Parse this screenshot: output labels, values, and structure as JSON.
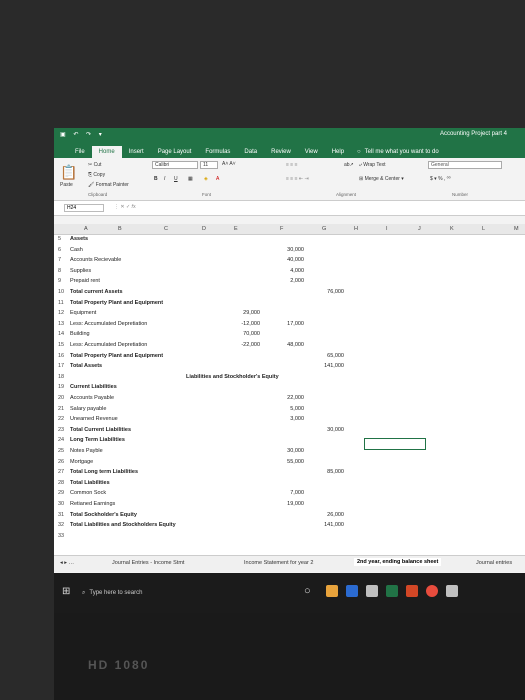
{
  "window": {
    "title": "Accounting Project part 4"
  },
  "tabs": [
    "File",
    "Home",
    "Insert",
    "Page Layout",
    "Formulas",
    "Data",
    "Review",
    "View",
    "Help"
  ],
  "tell_me": "Tell me what you want to do",
  "ribbon": {
    "cut": "Cut",
    "copy": "Copy",
    "format_painter": "Format Painter",
    "paste": "Paste",
    "font": "Calibri",
    "size": "11",
    "wrap_text": "Wrap Text",
    "merge_center": "Merge & Center",
    "number_format": "General",
    "groups": {
      "clipboard": "Clipboard",
      "font": "Font",
      "alignment": "Alignment",
      "number": "Number"
    }
  },
  "formula_bar": {
    "name_box": "H24"
  },
  "columns": [
    "A",
    "B",
    "C",
    "D",
    "E",
    "F",
    "G",
    "H",
    "I",
    "J",
    "K",
    "L",
    "M"
  ],
  "rows": [
    {
      "n": "5",
      "label": "Assets",
      "bold": true
    },
    {
      "n": "6",
      "label": "Cash",
      "f": "30,000"
    },
    {
      "n": "7",
      "label": "Accounts Recievable",
      "f": "40,000"
    },
    {
      "n": "8",
      "label": "Supplies",
      "f": "4,000"
    },
    {
      "n": "9",
      "label": "Prepaid rent",
      "f": "2,000"
    },
    {
      "n": "10",
      "label": "Total current Assets",
      "bold": true,
      "g": "76,000"
    },
    {
      "n": "11",
      "label": "Total Property Plant and Equipment",
      "bold": true
    },
    {
      "n": "12",
      "label": "Equipment",
      "e": "29,000"
    },
    {
      "n": "13",
      "label": "Less: Accumulated Depretiation",
      "e": "-12,000",
      "f": "17,000"
    },
    {
      "n": "14",
      "label": "Building",
      "e": "70,000"
    },
    {
      "n": "15",
      "label": "Less: Accumulated Depretiation",
      "e": "-22,000",
      "f": "48,000"
    },
    {
      "n": "16",
      "label": "Total Property Plant and Equipment",
      "bold": true,
      "g": "65,000"
    },
    {
      "n": "17",
      "label": "Total Assets",
      "bold": true,
      "g": "141,000"
    },
    {
      "n": "18",
      "label": "",
      "mid": "Liabilities and Stockholder's Equity"
    },
    {
      "n": "19",
      "label": "Current Liabilities",
      "bold": true
    },
    {
      "n": "20",
      "label": "Accounts Payable",
      "f": "22,000"
    },
    {
      "n": "21",
      "label": "Salary payable",
      "f": "5,000"
    },
    {
      "n": "22",
      "label": "Unearned Revenue",
      "f": "3,000"
    },
    {
      "n": "23",
      "label": "Total Current Liabilities",
      "bold": true,
      "g": "30,000"
    },
    {
      "n": "24",
      "label": "Long Term Liabilities",
      "bold": true
    },
    {
      "n": "25",
      "label": "Notes Payble",
      "f": "30,000"
    },
    {
      "n": "26",
      "label": "Mortgage",
      "f": "55,000"
    },
    {
      "n": "27",
      "label": "Total Long term Liabilities",
      "bold": true,
      "g": "85,000"
    },
    {
      "n": "28",
      "label": "Total Liabilities",
      "bold": true
    },
    {
      "n": "29",
      "label": "Common Sock",
      "f": "7,000"
    },
    {
      "n": "30",
      "label": "Retianed Earnings",
      "f": "19,000"
    },
    {
      "n": "31",
      "label": "Total Sockholder's Equity",
      "bold": true,
      "g": "26,000"
    },
    {
      "n": "32",
      "label": "Total Liabilities and Stockholders Equity",
      "bold": true,
      "g": "141,000"
    },
    {
      "n": "33",
      "label": ""
    }
  ],
  "sheets": [
    "Journal Entries - Income Stmt",
    "Income Statement for year 2",
    "2nd year, ending balance sheet",
    "Journal entries"
  ],
  "taskbar": {
    "search": "Type here to search"
  },
  "bezel_logo": "HD 1080"
}
